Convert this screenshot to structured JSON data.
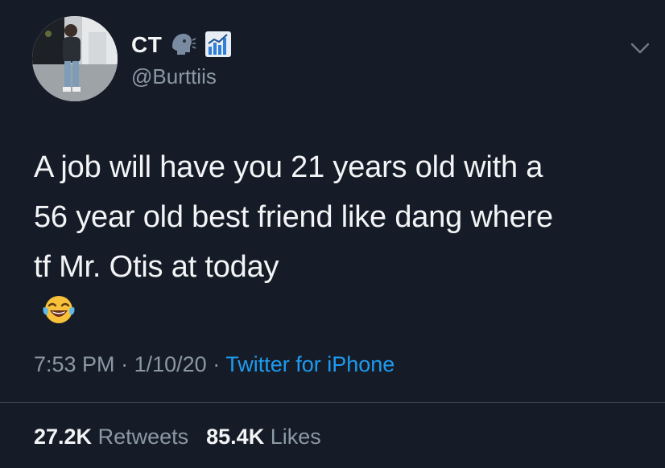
{
  "user": {
    "display_name": "CT",
    "handle": "@Burttiis",
    "name_emojis": [
      "speaking-head-icon",
      "chart-increasing-icon"
    ]
  },
  "tweet": {
    "lines": [
      "A job will have you 21 years old with a",
      "56 year old best friend like dang where",
      "tf Mr. Otis at today"
    ],
    "emoji": "face-with-tears-of-joy-icon"
  },
  "meta": {
    "time": "7:53 PM",
    "date": "1/10/20",
    "separator": "·",
    "source": "Twitter for iPhone"
  },
  "stats": {
    "retweets_count": "27.2K",
    "retweets_label": "Retweets",
    "likes_count": "85.4K",
    "likes_label": "Likes"
  },
  "colors": {
    "background": "#161c27",
    "primary_text": "#f2f4f6",
    "secondary_text": "#8b98a5",
    "accent": "#1d9bf0",
    "divider": "#38444d"
  }
}
